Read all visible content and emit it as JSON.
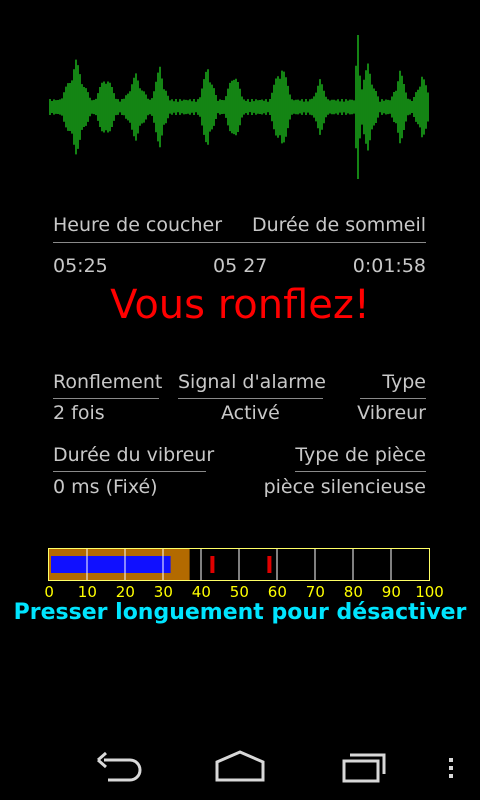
{
  "colors": {
    "waveform": "#22dd22",
    "alert": "#ff0000",
    "meter_fill": "#1010ff",
    "meter_bg": "#b36a00",
    "meter_marker": "#e00000",
    "tick_label": "#ffff00",
    "instruction": "#00e5ff"
  },
  "sleep": {
    "bedtime_header": "Heure de coucher",
    "duration_header": "Durée de sommeil",
    "bedtime_value": "05:25",
    "current_value": "05 27",
    "duration_value": "0:01:58"
  },
  "status": {
    "message": "Vous ronflez!"
  },
  "details": {
    "snoring_header": "Ronflement",
    "snoring_value": "2 fois",
    "alarm_header": "Signal d'alarme",
    "alarm_value": "Activé",
    "type_header": "Type",
    "type_value": "Vibreur",
    "vibe_duration_header": "Durée du vibreur",
    "vibe_duration_value": "0 ms (Fixé)",
    "room_type_header": "Type de pièce",
    "room_type_value": "pièce silencieuse"
  },
  "meter": {
    "level": 32,
    "background_level": 37,
    "markers": [
      43,
      58
    ],
    "ticks": [
      "0",
      "10",
      "20",
      "30",
      "40",
      "50",
      "60",
      "70",
      "80",
      "90",
      "100"
    ]
  },
  "instruction": {
    "text": "Presser longuement pour désactiver"
  },
  "navbar": {
    "back_icon": "back-icon",
    "home_icon": "home-icon",
    "recents_icon": "recents-icon",
    "menu_icon": "menu-icon"
  }
}
